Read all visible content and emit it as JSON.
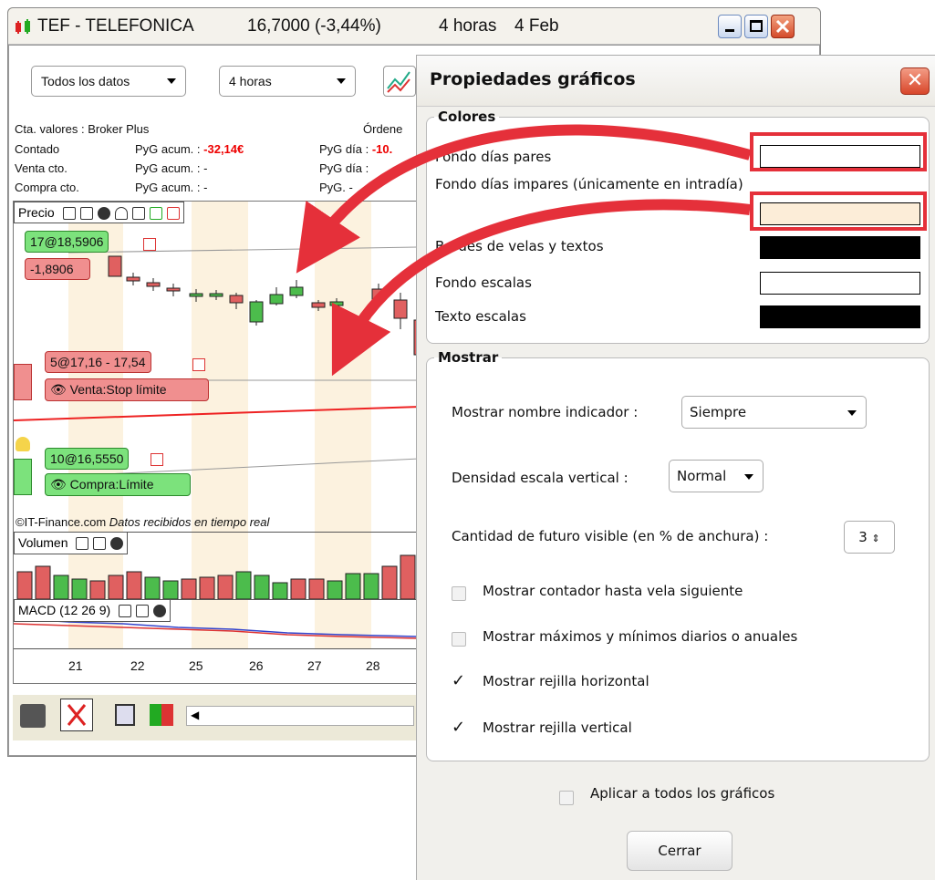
{
  "main_window": {
    "title": "TEF - TELEFONICA",
    "price": "16,7000 (-3,44%)",
    "period": "4 horas",
    "date": "4 Feb",
    "combo_data": "Todos los datos",
    "combo_period": "4 horas"
  },
  "account": {
    "row1_label": "Cta. valores : Broker Plus",
    "row1_right": "Órdene",
    "rows": [
      {
        "label": "Contado",
        "pyg_acum": "PyG acum. :",
        "acum_val": "-32,14€",
        "pyg_dia": "PyG día :",
        "dia_val": "-10."
      },
      {
        "label": "Venta cto.",
        "pyg_acum": "PyG acum. : -",
        "acum_val": "",
        "pyg_dia": "PyG día :",
        "dia_val": ""
      },
      {
        "label": "Compra cto.",
        "pyg_acum": "PyG acum. : -",
        "acum_val": "",
        "pyg_dia": "PyG",
        "dia_val": ". -"
      }
    ]
  },
  "chart": {
    "price_panel": "Precio",
    "tag_buy_pos": "17@18,5906",
    "tag_buy_pnl": "-1,8906",
    "tag_sell": "5@17,16 - 17,54",
    "tag_sell_order": "Venta:Stop límite",
    "tag_buy": "10@16,5550",
    "tag_buy_order": "Compra:Límite",
    "copyright": "©IT-Finance.com",
    "realtime": "Datos recibidos en tiempo real",
    "volume_panel": "Volumen",
    "macd_panel": "MACD (12 26 9)",
    "x_labels": [
      "21",
      "22",
      "25",
      "26",
      "27",
      "28"
    ]
  },
  "dialog": {
    "title": "Propiedades gráficos",
    "colors_legend": "Colores",
    "color_rows": [
      {
        "label": "Fondo días pares",
        "color": "#ffffff"
      },
      {
        "label": "Fondo días impares (únicamente en intradía)",
        "color": "#fcedd8"
      },
      {
        "label": "Bordes de velas y textos",
        "color": "#000000"
      },
      {
        "label": "Fondo escalas",
        "color": "#ffffff"
      },
      {
        "label": "Texto escalas",
        "color": "#000000"
      }
    ],
    "show_legend": "Mostrar",
    "indicator_name_label": "Mostrar nombre indicador :",
    "indicator_name_value": "Siempre",
    "density_label": "Densidad escala vertical :",
    "density_value": "Normal",
    "future_label": "Cantidad de futuro visible (en % de anchura) :",
    "future_value": "3",
    "checkboxes": [
      {
        "label": "Mostrar contador hasta vela siguiente",
        "checked": false
      },
      {
        "label": "Mostrar máximos y mínimos diarios o anuales",
        "checked": false
      },
      {
        "label": "Mostrar rejilla horizontal",
        "checked": true
      },
      {
        "label": "Mostrar rejilla vertical",
        "checked": true
      }
    ],
    "apply_all": "Aplicar a todos los gráficos",
    "close_button": "Cerrar"
  }
}
